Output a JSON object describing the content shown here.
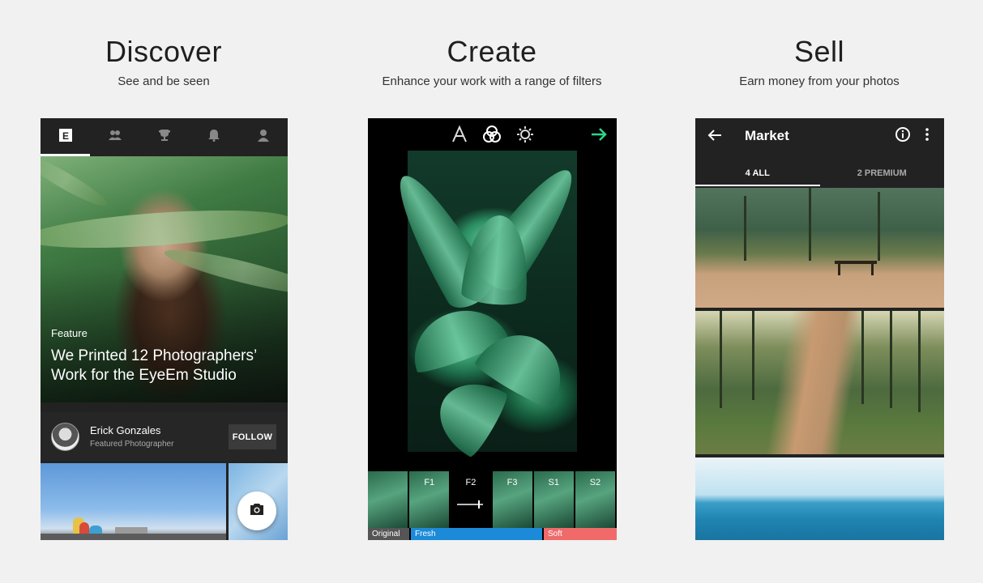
{
  "panels": [
    {
      "title": "Discover",
      "subtitle": "See and be seen"
    },
    {
      "title": "Create",
      "subtitle": "Enhance your work with a range of filters"
    },
    {
      "title": "Sell",
      "subtitle": "Earn money from your photos"
    }
  ],
  "discover": {
    "tabs": [
      "eyeem-logo-icon",
      "people-icon",
      "trophy-icon",
      "bell-icon",
      "profile-icon"
    ],
    "feature": {
      "kicker": "Feature",
      "title": "We Printed 12 Photographers’ Work for the EyeEm Studio"
    },
    "author": {
      "name": "Erick Gonzales",
      "role": "Featured Photographer",
      "follow_label": "FOLLOW"
    },
    "fab_icon": "camera-icon"
  },
  "create": {
    "tools": [
      "crop-icon",
      "filters-icon",
      "brightness-icon"
    ],
    "next_icon": "arrow-right-icon",
    "filters": [
      "",
      "F1",
      "F2",
      "F3",
      "S1",
      "S2"
    ],
    "groups": [
      {
        "label": "Original",
        "color": "#555555"
      },
      {
        "label": "Fresh",
        "color": "#1b8ad8"
      },
      {
        "label": "Soft",
        "color": "#f06a6a"
      }
    ]
  },
  "sell": {
    "title": "Market",
    "tabs": [
      "4 ALL",
      "2 PREMIUM"
    ]
  },
  "colors": {
    "accent_green": "#2bd78b",
    "bg": "#f1f1f1",
    "dark": "#222222"
  }
}
